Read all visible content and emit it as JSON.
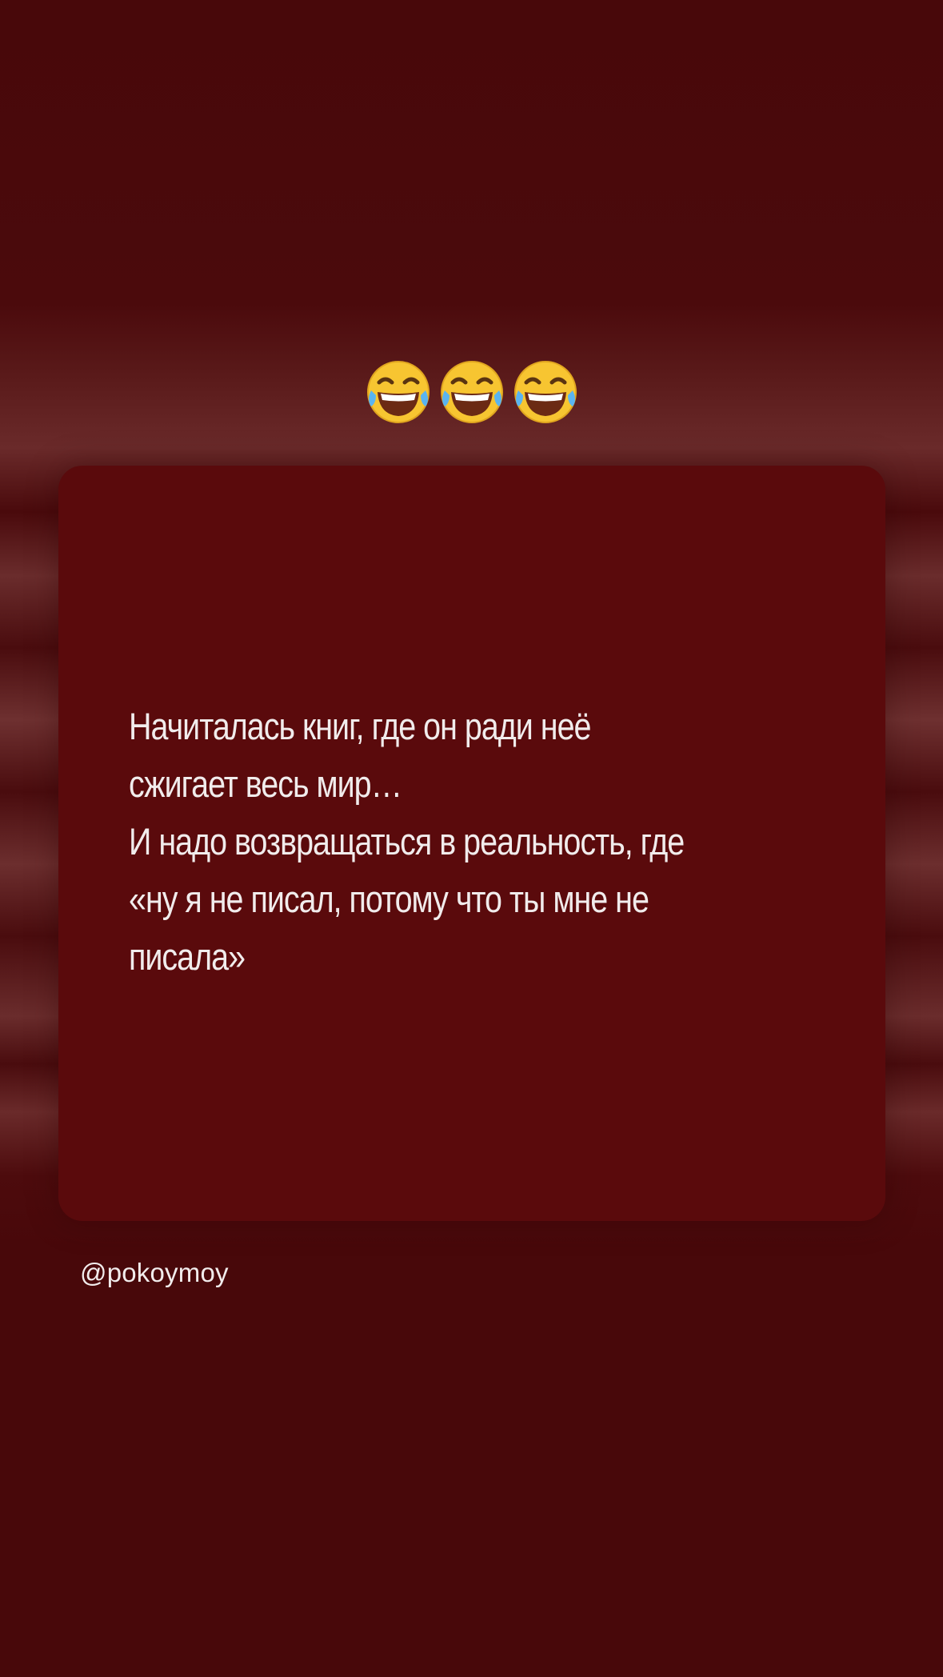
{
  "emojis": [
    {
      "icon": "face-with-tears-of-joy-icon"
    },
    {
      "icon": "face-with-tears-of-joy-icon"
    },
    {
      "icon": "face-with-tears-of-joy-icon"
    }
  ],
  "card": {
    "lines": [
      "Начиталась книг, где он ради неё",
      "сжигает весь мир…",
      "И надо возвращаться в реальность, где",
      "«ну я не писал, потому что ты мне не",
      "писала»"
    ]
  },
  "username": "@pokoymoy",
  "colors": {
    "background": "#48080a",
    "card": "#5a0a0c",
    "text": "#f1ecec"
  }
}
